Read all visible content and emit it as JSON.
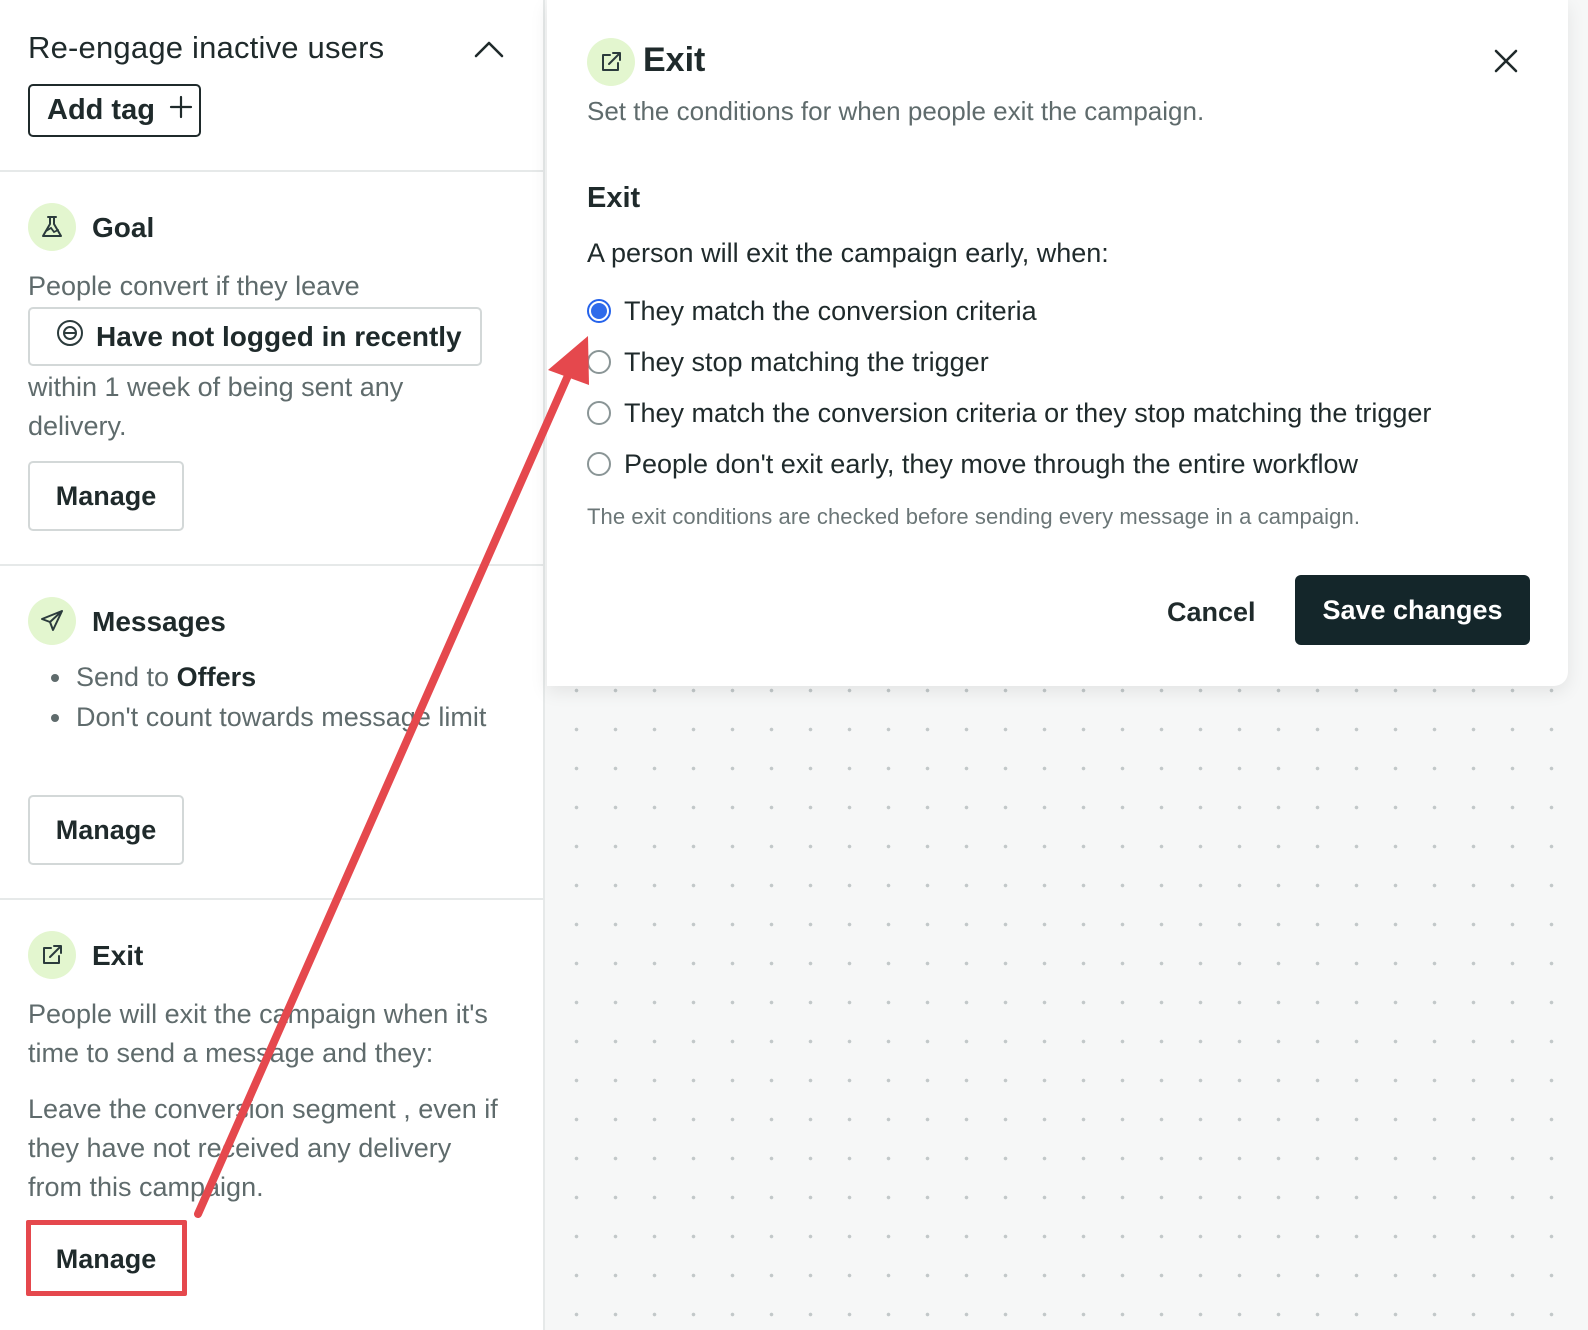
{
  "sidebar": {
    "campaign_title": "Re-engage inactive users",
    "add_tag_label": "Add tag",
    "goal": {
      "title": "Goal",
      "text_before": "People convert if they leave",
      "segment": "Have not logged in recently",
      "text_after": "within 1 week of being sent any delivery.",
      "manage_label": "Manage"
    },
    "messages": {
      "title": "Messages",
      "bullet1_prefix": "Send to",
      "bullet1_value": "Offers",
      "bullet2": "Don't count towards message limit",
      "manage_label": "Manage"
    },
    "exit": {
      "title": "Exit",
      "text1": "People will exit the campaign when it's time to send a message and they:",
      "text2": "Leave the conversion segment , even if they have not received any delivery from this campaign.",
      "manage_label": "Manage"
    }
  },
  "modal": {
    "title": "Exit",
    "subtitle": "Set the conditions for when people exit the campaign.",
    "section_heading": "Exit",
    "question": "A person will exit the campaign early, when:",
    "options": [
      {
        "label": "They match the conversion criteria",
        "selected": true
      },
      {
        "label": "They stop matching the trigger",
        "selected": false
      },
      {
        "label": "They match the conversion criteria or they stop matching the trigger",
        "selected": false
      },
      {
        "label": "People don't exit early, they move through the entire workflow",
        "selected": false
      }
    ],
    "note": "The exit conditions are checked before sending every message in a campaign.",
    "cancel_label": "Cancel",
    "save_label": "Save changes"
  },
  "colors": {
    "accent_blue": "#2f6bea",
    "icon_bg": "#e3f6cf",
    "annotation_red": "#e5484d",
    "primary_dark": "#14262a"
  },
  "icons": {
    "goal": "flask-icon",
    "messages": "paper-plane-icon",
    "exit": "external-link-icon",
    "segment": "segment-icon",
    "close": "close-icon",
    "collapse": "chevron-up-icon",
    "add": "plus-icon"
  }
}
